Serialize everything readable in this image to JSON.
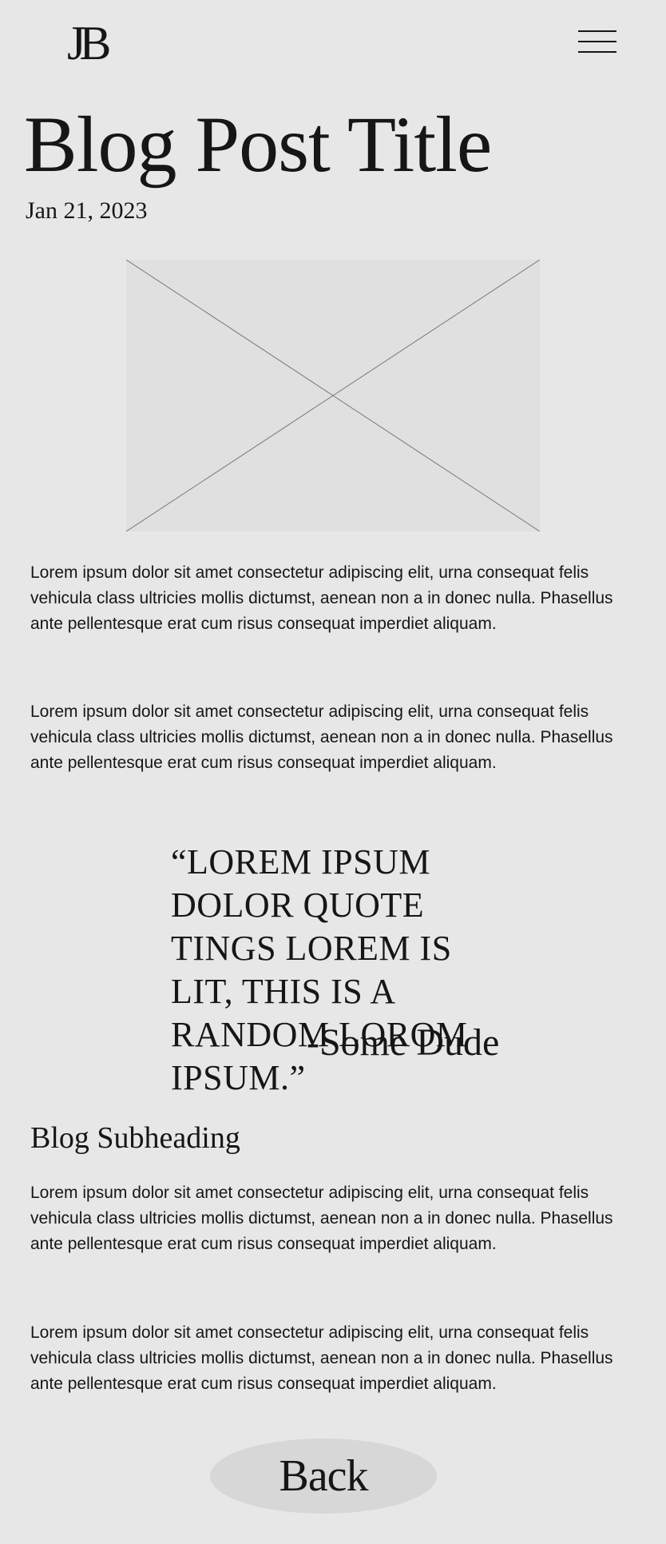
{
  "header": {
    "logo": "JB",
    "menu_icon": "hamburger-menu-icon"
  },
  "post": {
    "title": "Blog Post Title",
    "date": "Jan 21, 2023",
    "image_icon": "image-placeholder",
    "paragraphs": [
      "Lorem ipsum dolor sit amet consectetur adipiscing elit, urna consequat felis vehicula class ultricies mollis dictumst, aenean non a in donec nulla. Phasellus ante pellentesque erat cum risus consequat imperdiet aliquam.",
      "Lorem ipsum dolor sit amet consectetur adipiscing elit, urna consequat felis vehicula class ultricies mollis dictumst, aenean non a in donec nulla. Phasellus ante pellentesque erat cum risus consequat imperdiet aliquam.",
      "Lorem ipsum dolor sit amet consectetur adipiscing elit, urna consequat felis vehicula class ultricies mollis dictumst, aenean non a in donec nulla. Phasellus ante pellentesque erat cum risus consequat imperdiet aliquam.",
      "Lorem ipsum dolor sit amet consectetur adipiscing elit, urna consequat felis vehicula class ultricies mollis dictumst, aenean non a in donec nulla. Phasellus ante pellentesque erat cum risus consequat imperdiet aliquam."
    ],
    "quote": "“LOREM IPSUM DOLOR QUOTE TINGS LOREM IS LIT, THIS IS A RANDOM LOROM IPSUM.”",
    "quote_author": "-Some Dude",
    "subheading": "Blog Subheading"
  },
  "footer": {
    "back_label": "Back"
  },
  "colors": {
    "background": "#e7e7e7",
    "text": "#161616",
    "image_placeholder": "#e0e0e0",
    "button": "#d7d7d7"
  }
}
